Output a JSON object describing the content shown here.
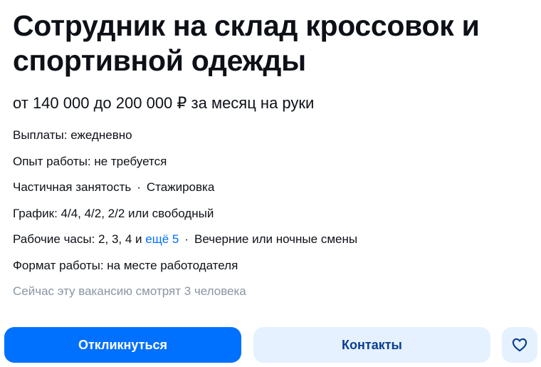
{
  "vacancy": {
    "title": "Сотрудник на склад кроссовок и спортивной одежды",
    "salary": "от 140 000 до 200 000 ₽ за месяц на руки",
    "payouts": "Выплаты: ежедневно",
    "experience": "Опыт работы: не требуется",
    "employment": "Частичная занятость",
    "employment_extra": "Стажировка",
    "schedule": "График: 4/4, 4/2, 2/2 или свободный",
    "hours_prefix": "Рабочие часы: 2, 3, 4 и",
    "hours_more_link": "ещё 5",
    "shifts": "Вечерние или ночные смены",
    "work_format": "Формат работы: на месте работодателя",
    "viewers": "Сейчас эту вакансию смотрят 3 человека",
    "separator": "·"
  },
  "actions": {
    "apply_label": "Откликнуться",
    "contacts_label": "Контакты",
    "favorite_icon": "heart-outline-icon"
  },
  "colors": {
    "accent": "#0070ff",
    "secondary_bg": "#e5f1ff",
    "secondary_text": "#0b3d91",
    "muted_text": "#8a96a3"
  }
}
